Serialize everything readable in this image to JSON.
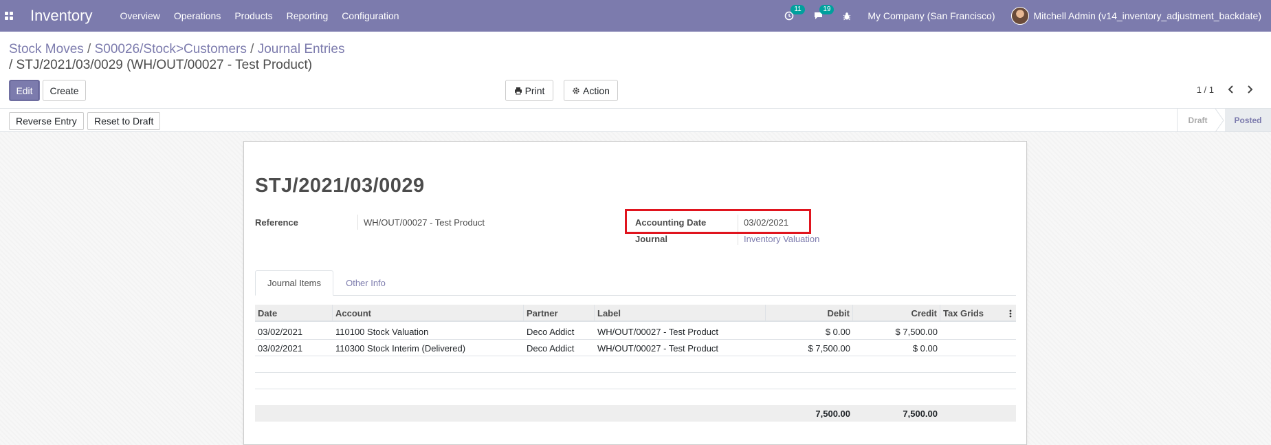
{
  "navbar": {
    "app_name": "Inventory",
    "menu": [
      "Overview",
      "Operations",
      "Products",
      "Reporting",
      "Configuration"
    ],
    "activity_count": "11",
    "message_count": "19",
    "company": "My Company (San Francisco)",
    "user": "Mitchell Admin (v14_inventory_adjustment_backdate)"
  },
  "breadcrumb": {
    "items": [
      "Stock Moves",
      "S00026/Stock>Customers",
      "Journal Entries"
    ],
    "separator": " / ",
    "current": " / STJ/2021/03/0029 (WH/OUT/00027 - Test Product)"
  },
  "buttons": {
    "edit": "Edit",
    "create": "Create",
    "print": "Print",
    "action": "Action"
  },
  "pager": {
    "value": "1 / 1"
  },
  "statusbar": {
    "reverse_entry": "Reverse Entry",
    "reset_to_draft": "Reset to Draft",
    "stages": [
      "Draft",
      "Posted"
    ],
    "active_stage": "Posted"
  },
  "record": {
    "name": "STJ/2021/03/0029",
    "reference_label": "Reference",
    "reference_value": "WH/OUT/00027 - Test Product",
    "accounting_date_label": "Accounting Date",
    "accounting_date_value": "03/02/2021",
    "journal_label": "Journal",
    "journal_value": "Inventory Valuation"
  },
  "tabs": [
    "Journal Items",
    "Other Info"
  ],
  "journal_items": {
    "columns": [
      "Date",
      "Account",
      "Partner",
      "Label",
      "Debit",
      "Credit",
      "Tax Grids"
    ],
    "rows": [
      [
        "03/02/2021",
        "110100 Stock Valuation",
        "Deco Addict",
        "WH/OUT/00027 - Test Product",
        "$ 0.00",
        "$ 7,500.00",
        ""
      ],
      [
        "03/02/2021",
        "110300 Stock Interim (Delivered)",
        "Deco Addict",
        "WH/OUT/00027 - Test Product",
        "$ 7,500.00",
        "$ 0.00",
        ""
      ]
    ],
    "total_debit": "7,500.00",
    "total_credit": "7,500.00"
  },
  "colors": {
    "brand": "#7c7bad",
    "badge": "#00a09d",
    "highlight": "#e0141e"
  }
}
